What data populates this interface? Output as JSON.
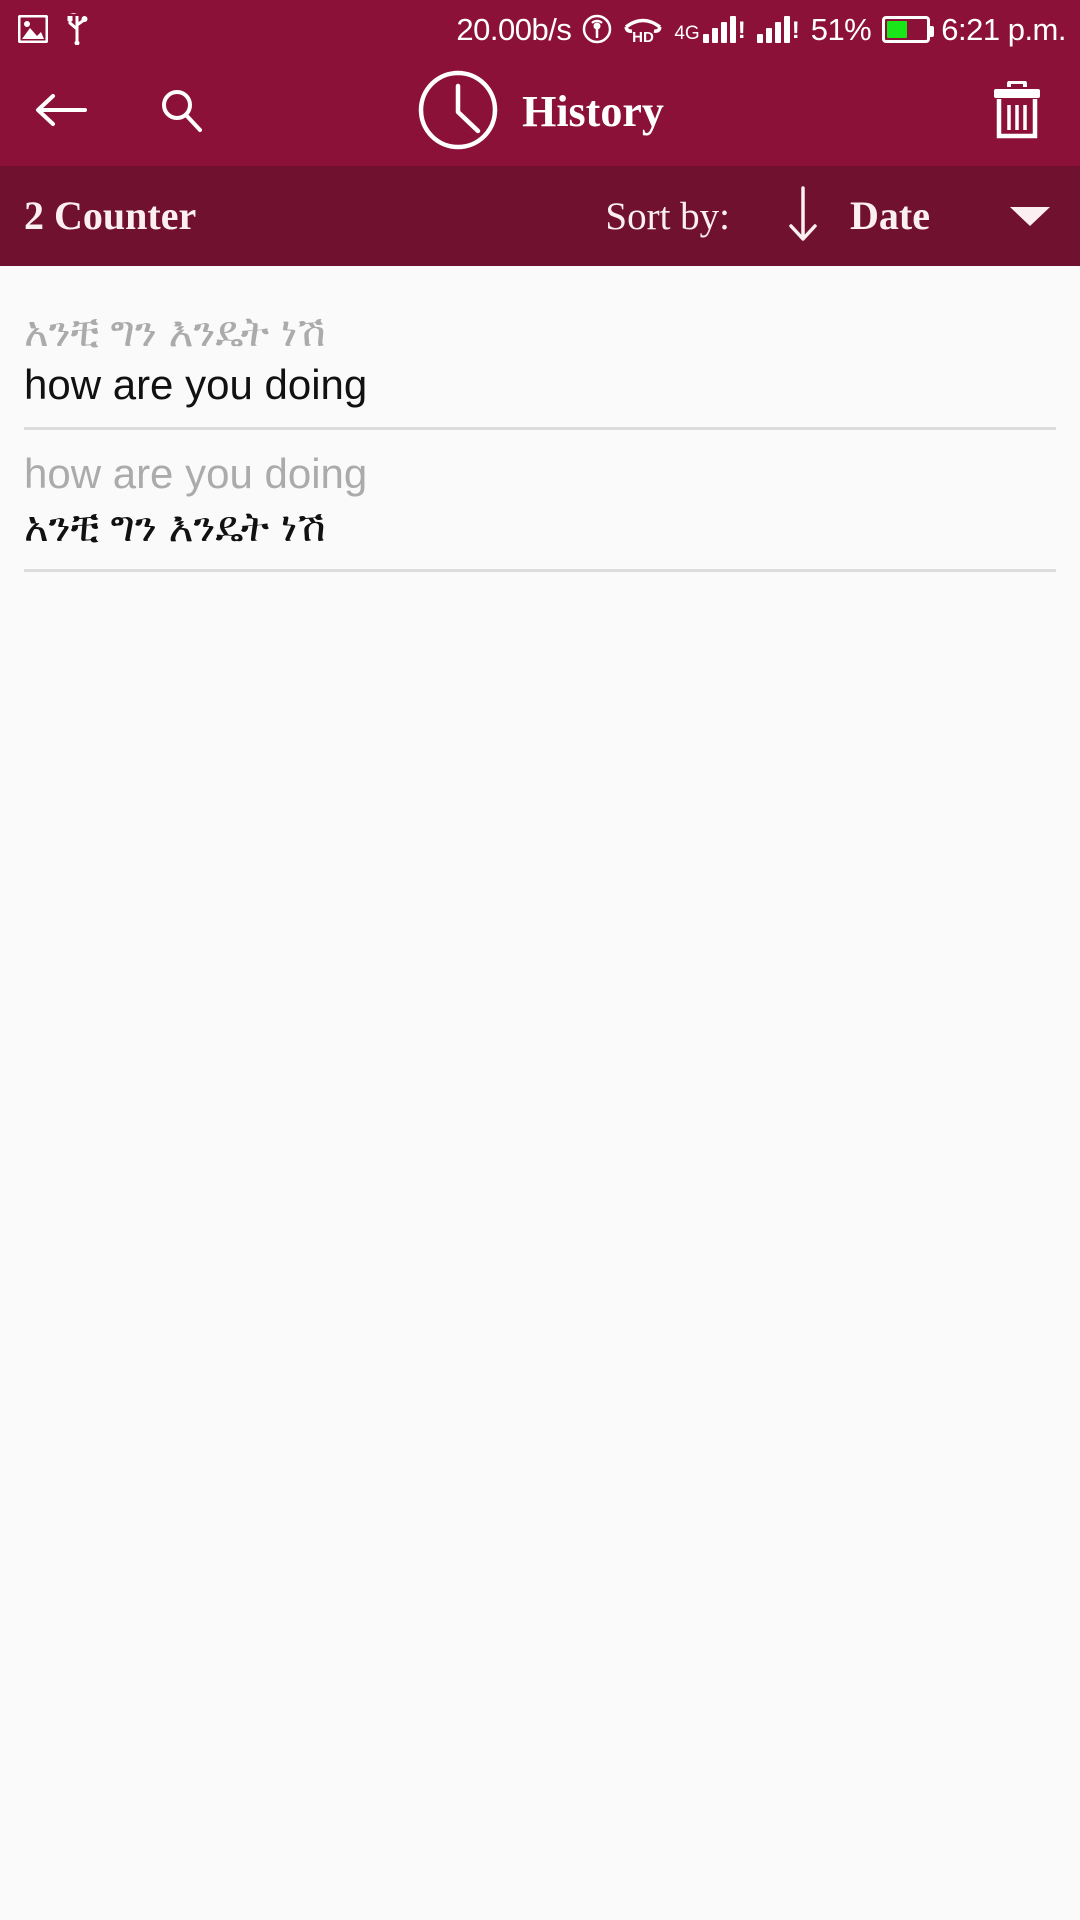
{
  "theme": {
    "appbar_color": "#8C1139",
    "sortbar_color": "#711130",
    "content_bg": "#FAFAFA",
    "primary_text": "#111111",
    "secondary_text": "#ABABAB",
    "divider_color": "#DCDCDC",
    "battery_fill": "#19E619"
  },
  "statusbar": {
    "left_icons": [
      "image-icon",
      "usb-icon"
    ],
    "network_speed": "20.00b/s",
    "hotspot_icon": "hotspot-icon",
    "hd_label": "HD",
    "network_type": "4G",
    "sim1_icon": "signal-bars-icon",
    "sim2_icon": "signal-bars-icon",
    "battery_percent": "51%",
    "battery_level": 51,
    "time": "6:21 p.m."
  },
  "appbar": {
    "back_icon": "back-arrow-icon",
    "search_icon": "search-icon",
    "clock_icon": "clock-icon",
    "title": "History",
    "delete_icon": "trash-icon"
  },
  "sortbar": {
    "counter": "2 Counter",
    "sort_label": "Sort by:",
    "sort_direction_icon": "arrow-down-icon",
    "sort_value": "Date",
    "dropdown_icon": "caret-down-icon"
  },
  "history": {
    "items": [
      {
        "source": "አንቺ ግን እንዴት ነሽ",
        "target": "how are you doing",
        "source_is_primary": false
      },
      {
        "source": "how are you doing",
        "target": "አንቺ ግን እንዴት ነሽ",
        "source_is_primary": false
      }
    ]
  }
}
